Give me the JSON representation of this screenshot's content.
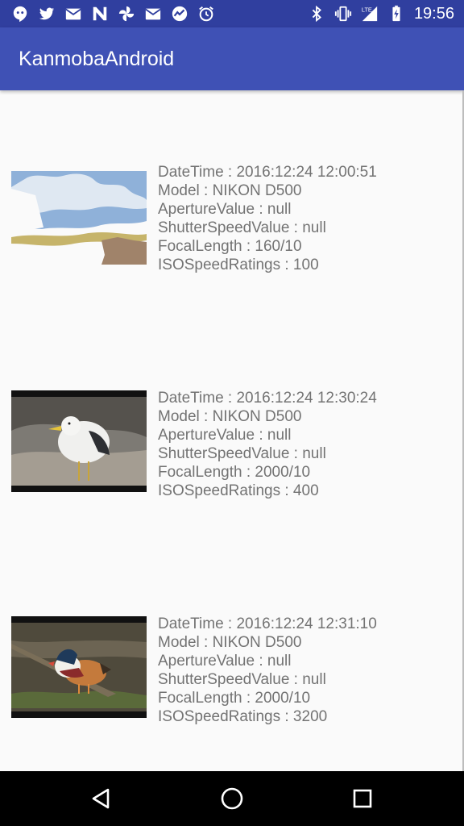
{
  "status_bar": {
    "time": "19:56",
    "left_icons": [
      "hangouts-icon",
      "twitter-icon",
      "mail-icon",
      "n-app-icon",
      "pinwheel-icon",
      "mail-icon",
      "chart-app-icon",
      "alarm-icon"
    ],
    "right_icons": [
      "bluetooth-icon",
      "vibrate-icon",
      "lte-signal-icon",
      "battery-charging-icon"
    ]
  },
  "app_bar": {
    "title": "KanmobaAndroid"
  },
  "photos": [
    {
      "thumbnail": "sky-landscape-thumbnail",
      "datetime": "DateTime : 2016:12:24 12:00:51",
      "model": "Model : NIKON D500",
      "aperture": "ApertureValue : null",
      "shutter": "ShutterSpeedValue : null",
      "focal": "FocalLength : 160/10",
      "iso": "ISOSpeedRatings : 100"
    },
    {
      "thumbnail": "seagull-thumbnail",
      "datetime": "DateTime : 2016:12:24 12:30:24",
      "model": "Model : NIKON D500",
      "aperture": "ApertureValue : null",
      "shutter": "ShutterSpeedValue : null",
      "focal": "FocalLength : 2000/10",
      "iso": "ISOSpeedRatings : 400"
    },
    {
      "thumbnail": "mandarin-duck-thumbnail",
      "datetime": "DateTime : 2016:12:24 12:31:10",
      "model": "Model : NIKON D500",
      "aperture": "ApertureValue : null",
      "shutter": "ShutterSpeedValue : null",
      "focal": "FocalLength : 2000/10",
      "iso": "ISOSpeedRatings : 3200"
    }
  ],
  "nav_bar": {
    "buttons": [
      "back-icon",
      "home-icon",
      "recents-icon"
    ]
  },
  "colors": {
    "status_bar": "#303f9f",
    "app_bar": "#3f51b5",
    "text": "#737373",
    "background": "#fafafa"
  }
}
